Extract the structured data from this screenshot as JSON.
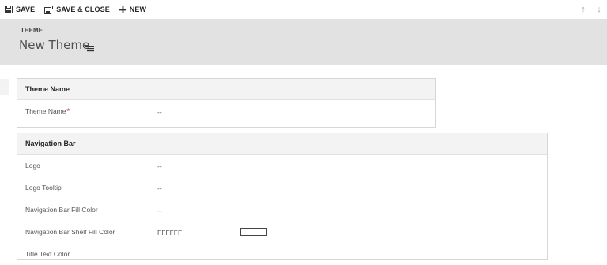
{
  "toolbar": {
    "save_label": "SAVE",
    "save_close_label": "SAVE & CLOSE",
    "new_label": "NEW",
    "up_arrow": "↑",
    "down_arrow": "↓"
  },
  "header": {
    "entity": "THEME",
    "title": "New Theme"
  },
  "sections": {
    "theme_name": {
      "title": "Theme Name",
      "fields": {
        "name_label": "Theme Name",
        "name_required": "*",
        "name_value": "--"
      }
    },
    "navigation_bar": {
      "title": "Navigation Bar",
      "fields": [
        {
          "label": "Logo",
          "value": "--"
        },
        {
          "label": "Logo Tooltip",
          "value": "--"
        },
        {
          "label": "Navigation Bar Fill Color",
          "value": "--"
        },
        {
          "label": "Navigation Bar Shelf Fill Color",
          "value": "FFFFFF",
          "swatch": "#FFFFFF"
        },
        {
          "label": "Title Text Color",
          "value": ""
        }
      ]
    }
  },
  "colors": {
    "header_band": "#e2e2e2",
    "section_head": "#f3f3f3",
    "required": "#c00000"
  }
}
